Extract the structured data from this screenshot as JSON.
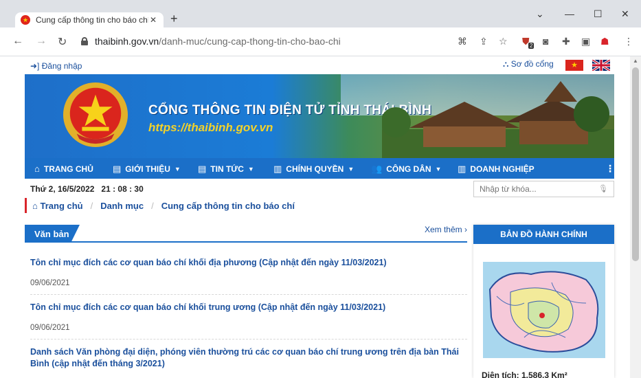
{
  "browser": {
    "tab_title": "Cung cấp thông tin cho báo chí",
    "tab_close": "✕",
    "new_tab": "+",
    "url_domain": "thaibinh.gov.vn",
    "url_path": "/danh-muc/cung-cap-thong-tin-cho-bao-chi",
    "extension_badge": "2"
  },
  "top": {
    "login": "Đăng nhập",
    "sitemap": "Sơ đồ cổng"
  },
  "banner": {
    "title": "CỔNG THÔNG TIN ĐIỆN TỬ TỈNH THÁI BÌNH",
    "url": "https://thaibinh.gov.vn"
  },
  "nav": [
    {
      "label": "TRANG CHỦ",
      "icon": "bank-icon"
    },
    {
      "label": "GIỚI THIỆU",
      "icon": "document-icon"
    },
    {
      "label": "TIN TỨC",
      "icon": "document-icon"
    },
    {
      "label": "CHÍNH QUYỀN",
      "icon": "building-icon"
    },
    {
      "label": "CÔNG DÂN",
      "icon": "people-icon"
    },
    {
      "label": "DOANH NGHIỆP",
      "icon": "building-icon"
    }
  ],
  "datetime": "Thứ 2, 16/5/2022   21 : 08 : 30",
  "search": {
    "placeholder": "Nhập từ khóa..."
  },
  "breadcrumb": [
    "Trang chủ",
    "Danh mục",
    "Cung cấp thông tin cho báo chí"
  ],
  "section": {
    "title": "Văn bản",
    "more": "Xem thêm"
  },
  "news": [
    {
      "title": "Tôn chỉ mục đích các cơ quan báo chí khối địa phương (Cập nhật đến ngày 11/03/2021)",
      "date": "09/06/2021"
    },
    {
      "title": "Tôn chỉ mục đích các cơ quan báo chí khối trung ương (Cập nhật đến ngày 11/03/2021)",
      "date": "09/06/2021"
    },
    {
      "title": "Danh sách Văn phòng đại diện, phóng viên thường trú các cơ quan báo chí trung ương trên địa bàn Thái Bình (cập nhật đến tháng 3/2021)",
      "date": ""
    }
  ],
  "sidebar": {
    "map_title": "BẢN ĐỒ HÀNH CHÍNH",
    "area": "Diện tích: 1.586,3 Km²"
  },
  "colors": {
    "primary": "#1b6fc8",
    "accent_red": "#d9242b",
    "link": "#1a4f9c"
  }
}
